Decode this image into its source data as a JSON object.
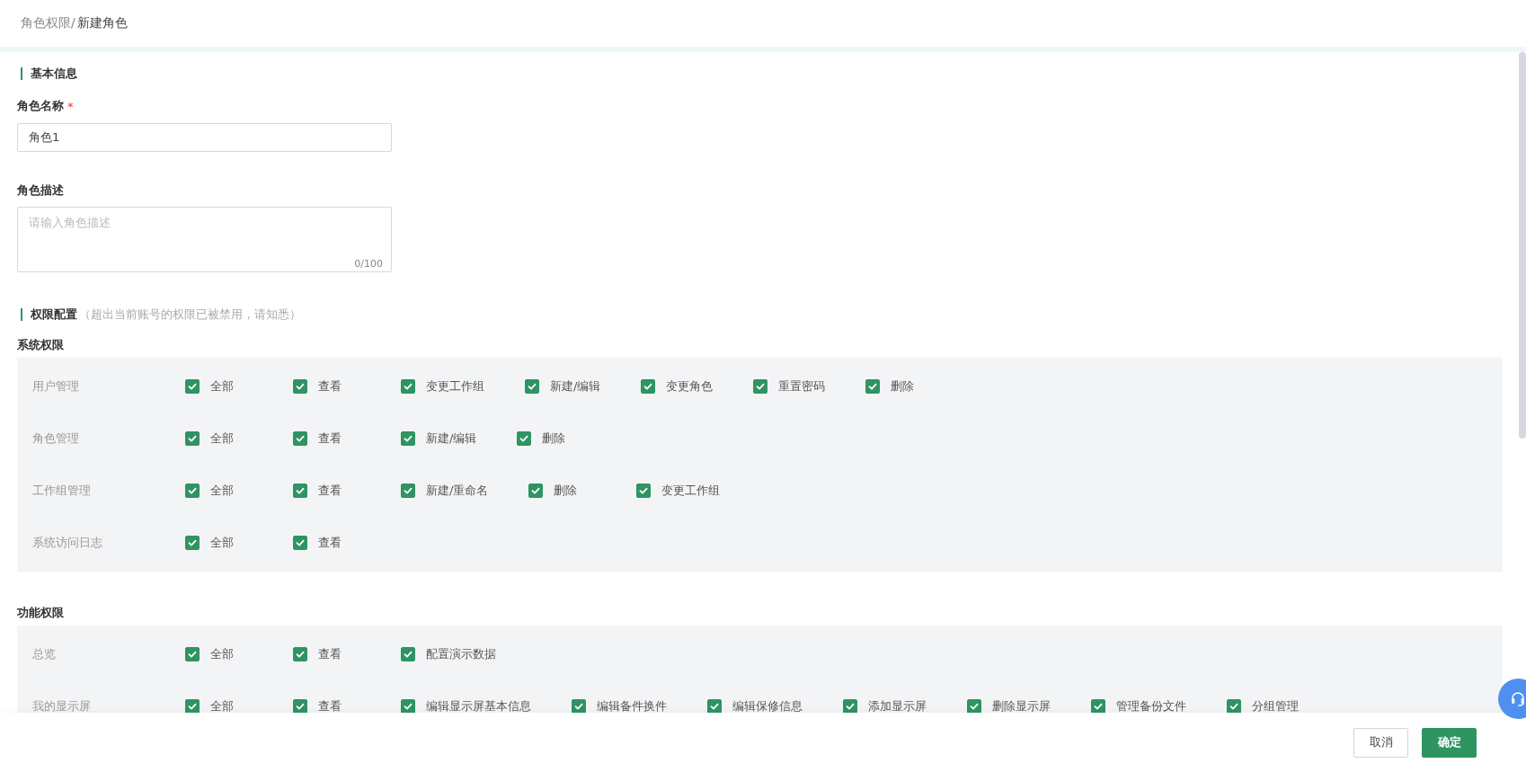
{
  "breadcrumb": {
    "parent": "角色权限/",
    "current": "新建角色"
  },
  "basic_info": {
    "title": "基本信息",
    "name_field": {
      "label": "角色名称",
      "required_mark": "*",
      "value": "角色1"
    },
    "description_field": {
      "label": "角色描述",
      "placeholder": "请输入角色描述",
      "counter": "0/100"
    }
  },
  "permissions": {
    "title": "权限配置",
    "note": "（超出当前账号的权限已被禁用，请知悉）",
    "groups": [
      {
        "title": "系统权限",
        "rows": [
          {
            "label": "用户管理",
            "options": [
              {
                "label": "全部",
                "checked": true
              },
              {
                "label": "查看",
                "checked": true
              },
              {
                "label": "变更工作组",
                "checked": true
              },
              {
                "label": "新建/编辑",
                "checked": true
              },
              {
                "label": "变更角色",
                "checked": true
              },
              {
                "label": "重置密码",
                "checked": true
              },
              {
                "label": "删除",
                "checked": true
              }
            ]
          },
          {
            "label": "角色管理",
            "options": [
              {
                "label": "全部",
                "checked": true
              },
              {
                "label": "查看",
                "checked": true
              },
              {
                "label": "新建/编辑",
                "checked": true
              },
              {
                "label": "删除",
                "checked": true
              }
            ]
          },
          {
            "label": "工作组管理",
            "options": [
              {
                "label": "全部",
                "checked": true
              },
              {
                "label": "查看",
                "checked": true
              },
              {
                "label": "新建/重命名",
                "checked": true
              },
              {
                "label": "删除",
                "checked": true
              },
              {
                "label": "变更工作组",
                "checked": true
              }
            ]
          },
          {
            "label": "系统访问日志",
            "options": [
              {
                "label": "全部",
                "checked": true
              },
              {
                "label": "查看",
                "checked": true
              }
            ]
          }
        ]
      },
      {
        "title": "功能权限",
        "rows": [
          {
            "label": "总览",
            "options": [
              {
                "label": "全部",
                "checked": true
              },
              {
                "label": "查看",
                "checked": true
              },
              {
                "label": "配置演示数据",
                "checked": true
              }
            ]
          },
          {
            "label": "我的显示屏",
            "options": [
              {
                "label": "全部",
                "checked": true
              },
              {
                "label": "查看",
                "checked": true
              },
              {
                "label": "编辑显示屏基本信息",
                "checked": true
              },
              {
                "label": "编辑备件换件",
                "checked": true
              },
              {
                "label": "编辑保修信息",
                "checked": true
              },
              {
                "label": "添加显示屏",
                "checked": true
              },
              {
                "label": "删除显示屏",
                "checked": true
              },
              {
                "label": "管理备份文件",
                "checked": true
              },
              {
                "label": "分组管理",
                "checked": true
              }
            ]
          }
        ]
      }
    ]
  },
  "footer": {
    "buttons": [
      {
        "label": "取消",
        "kind": "secondary"
      },
      {
        "label": "确定",
        "kind": "primary"
      }
    ]
  }
}
